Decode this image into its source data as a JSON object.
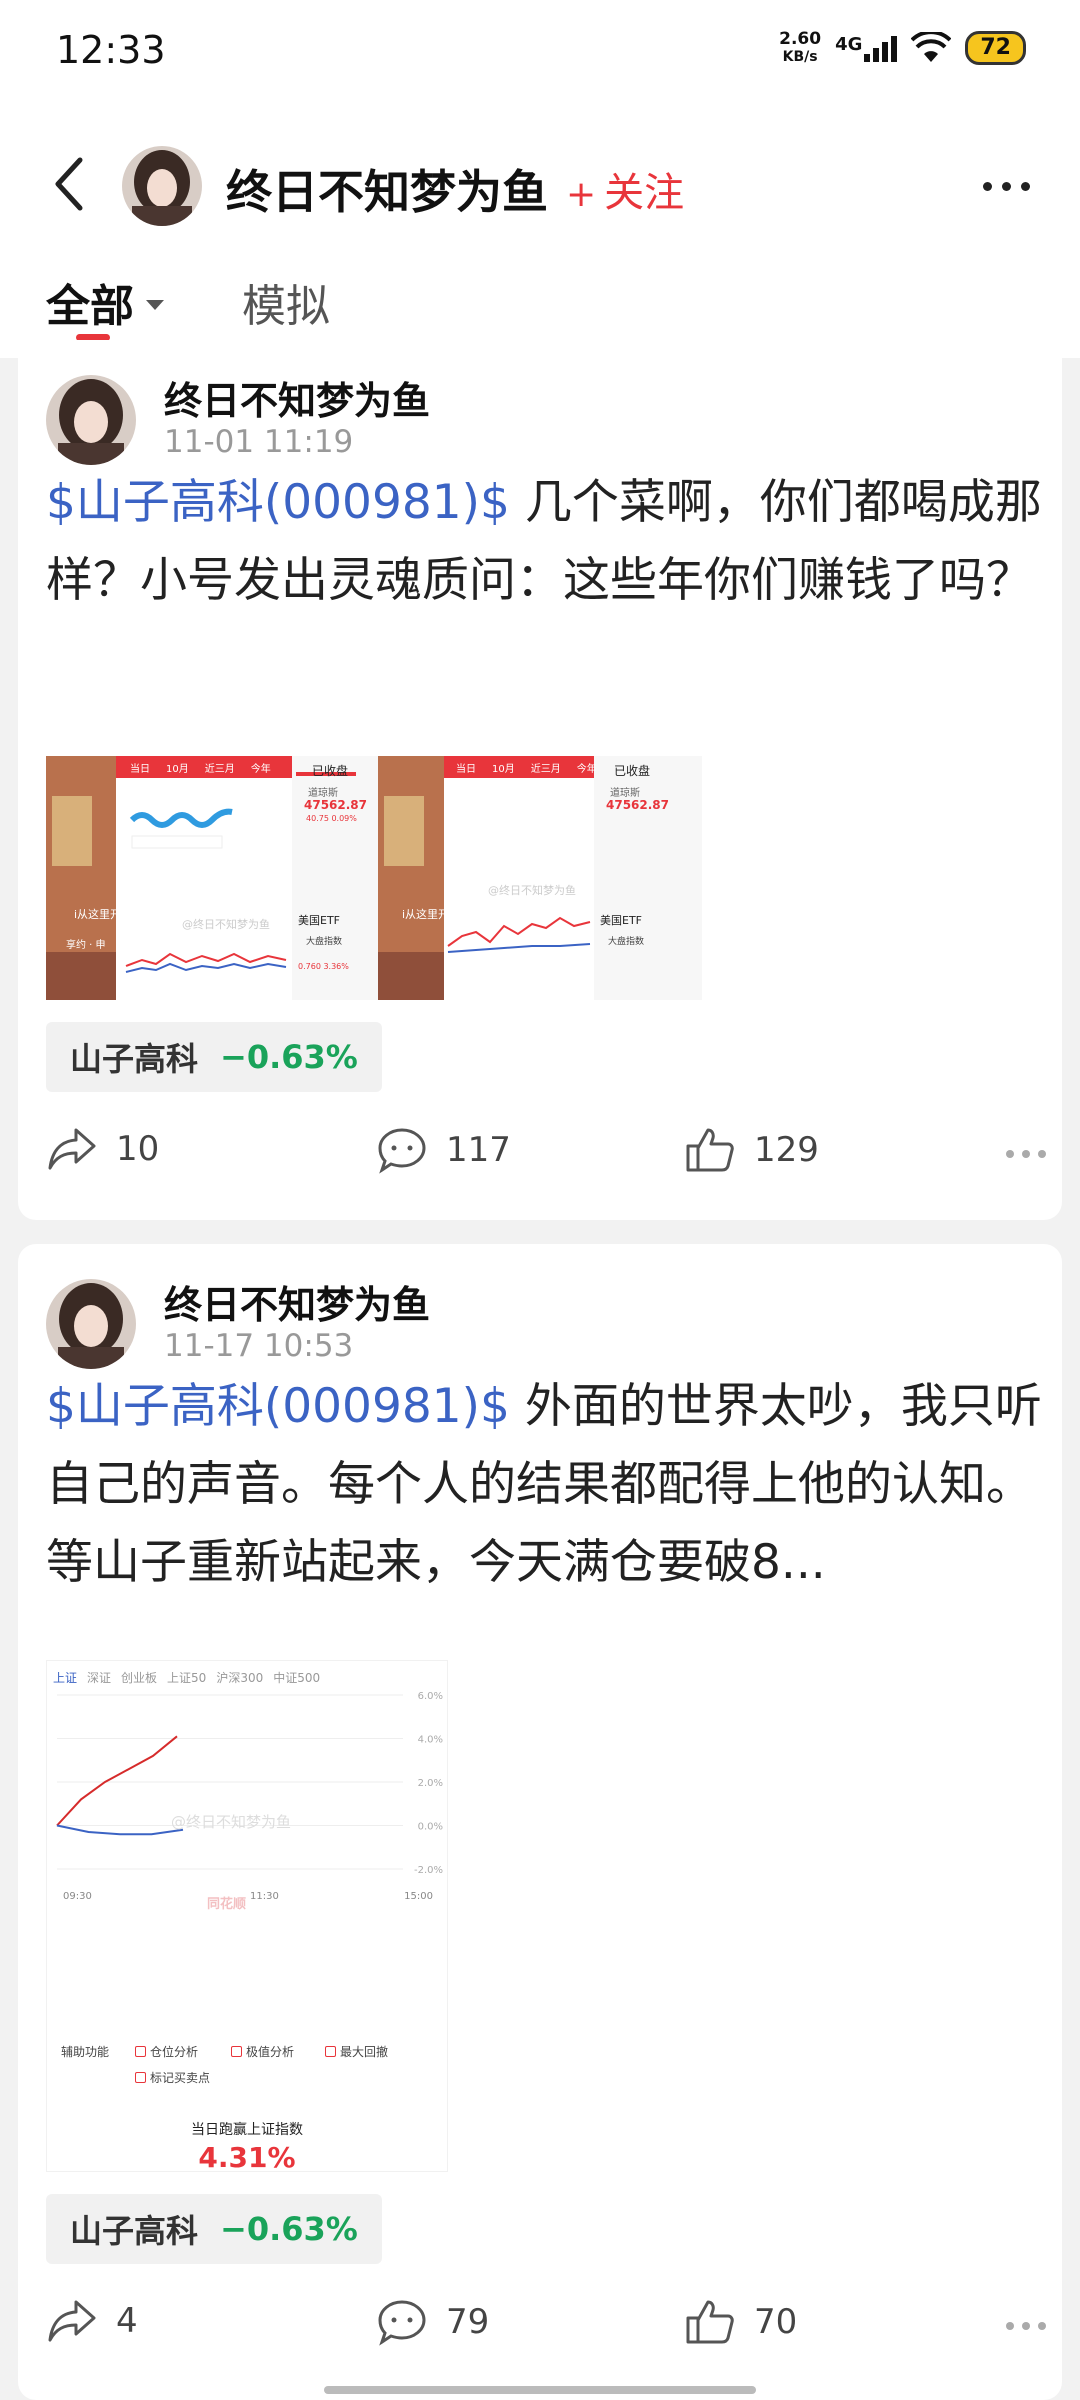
{
  "status_bar": {
    "time": "12:33",
    "speed_value": "2.60",
    "speed_unit": "KB/s",
    "network": "4G",
    "battery": "72"
  },
  "header": {
    "name": "终日不知梦为鱼",
    "follow_label": "关注",
    "follow_plus": "+",
    "accent_color": "#e8353b"
  },
  "tabs": {
    "all": "全部",
    "simulated": "模拟"
  },
  "posts": [
    {
      "author": "终日不知梦为鱼",
      "time": "11-01 11:19",
      "tag": "$山子高科(000981)$",
      "text": " 几个菜啊，你们都喝成那样？小号发出灵魂质问：这些年你们赚钱了吗？",
      "stock": {
        "name": "山子高科",
        "change": "−0.63%"
      },
      "shares": "10",
      "comments": "117",
      "likes": "129",
      "thumb": {
        "tabs": [
          "当日",
          "10月",
          "近三月",
          "今年"
        ],
        "status": "已收盘",
        "index_name": "道琼斯",
        "index_value": "47562.87",
        "index_change": "40.75",
        "index_pct": "0.09%",
        "etf_title": "美国ETF",
        "etf_name": "大盘指数",
        "etf_value": "0.760",
        "etf_pct": "3.36%",
        "watermark": "@终日不知梦为鱼",
        "left_label": "i从这里开",
        "left_sub": "享约 · 申"
      }
    },
    {
      "author": "终日不知梦为鱼",
      "time": "11-17 10:53",
      "tag": "$山子高科(000981)$",
      "text": " 外面的世界太吵，我只听自己的声音。每个人的结果都配得上他的认知。等山子重新站起来，今天满仓要破8...",
      "stock": {
        "name": "山子高科",
        "change": "−0.63%"
      },
      "shares": "4",
      "comments": "79",
      "likes": "70",
      "chart": {
        "index_tabs": [
          "上证",
          "深证",
          "创业板",
          "上证50",
          "沪深300",
          "中证500"
        ],
        "y_ticks": [
          "6.0%",
          "4.0%",
          "2.0%",
          "0.0%",
          "-2.0%"
        ],
        "x_ticks": [
          "09:30",
          "11:30",
          "15:00"
        ],
        "watermark": "@终日不知梦为鱼",
        "source_mark": "同花顺",
        "options_title": "辅助功能",
        "options": [
          "仓位分析",
          "极值分析",
          "最大回撤",
          "标记买卖点"
        ],
        "summary_title": "当日跑赢上证指数",
        "summary_value": "4.31%"
      }
    }
  ],
  "chart_data": {
    "type": "line",
    "ylim": [
      -2.0,
      6.0
    ],
    "x": [
      "09:30",
      "11:30",
      "15:00"
    ],
    "series": [
      {
        "values": [
          0.0,
          1.2,
          2.0,
          2.6,
          3.2,
          4.1
        ]
      },
      {
        "values": [
          0.0,
          -0.3,
          -0.4,
          -0.4,
          -0.2
        ]
      }
    ]
  }
}
